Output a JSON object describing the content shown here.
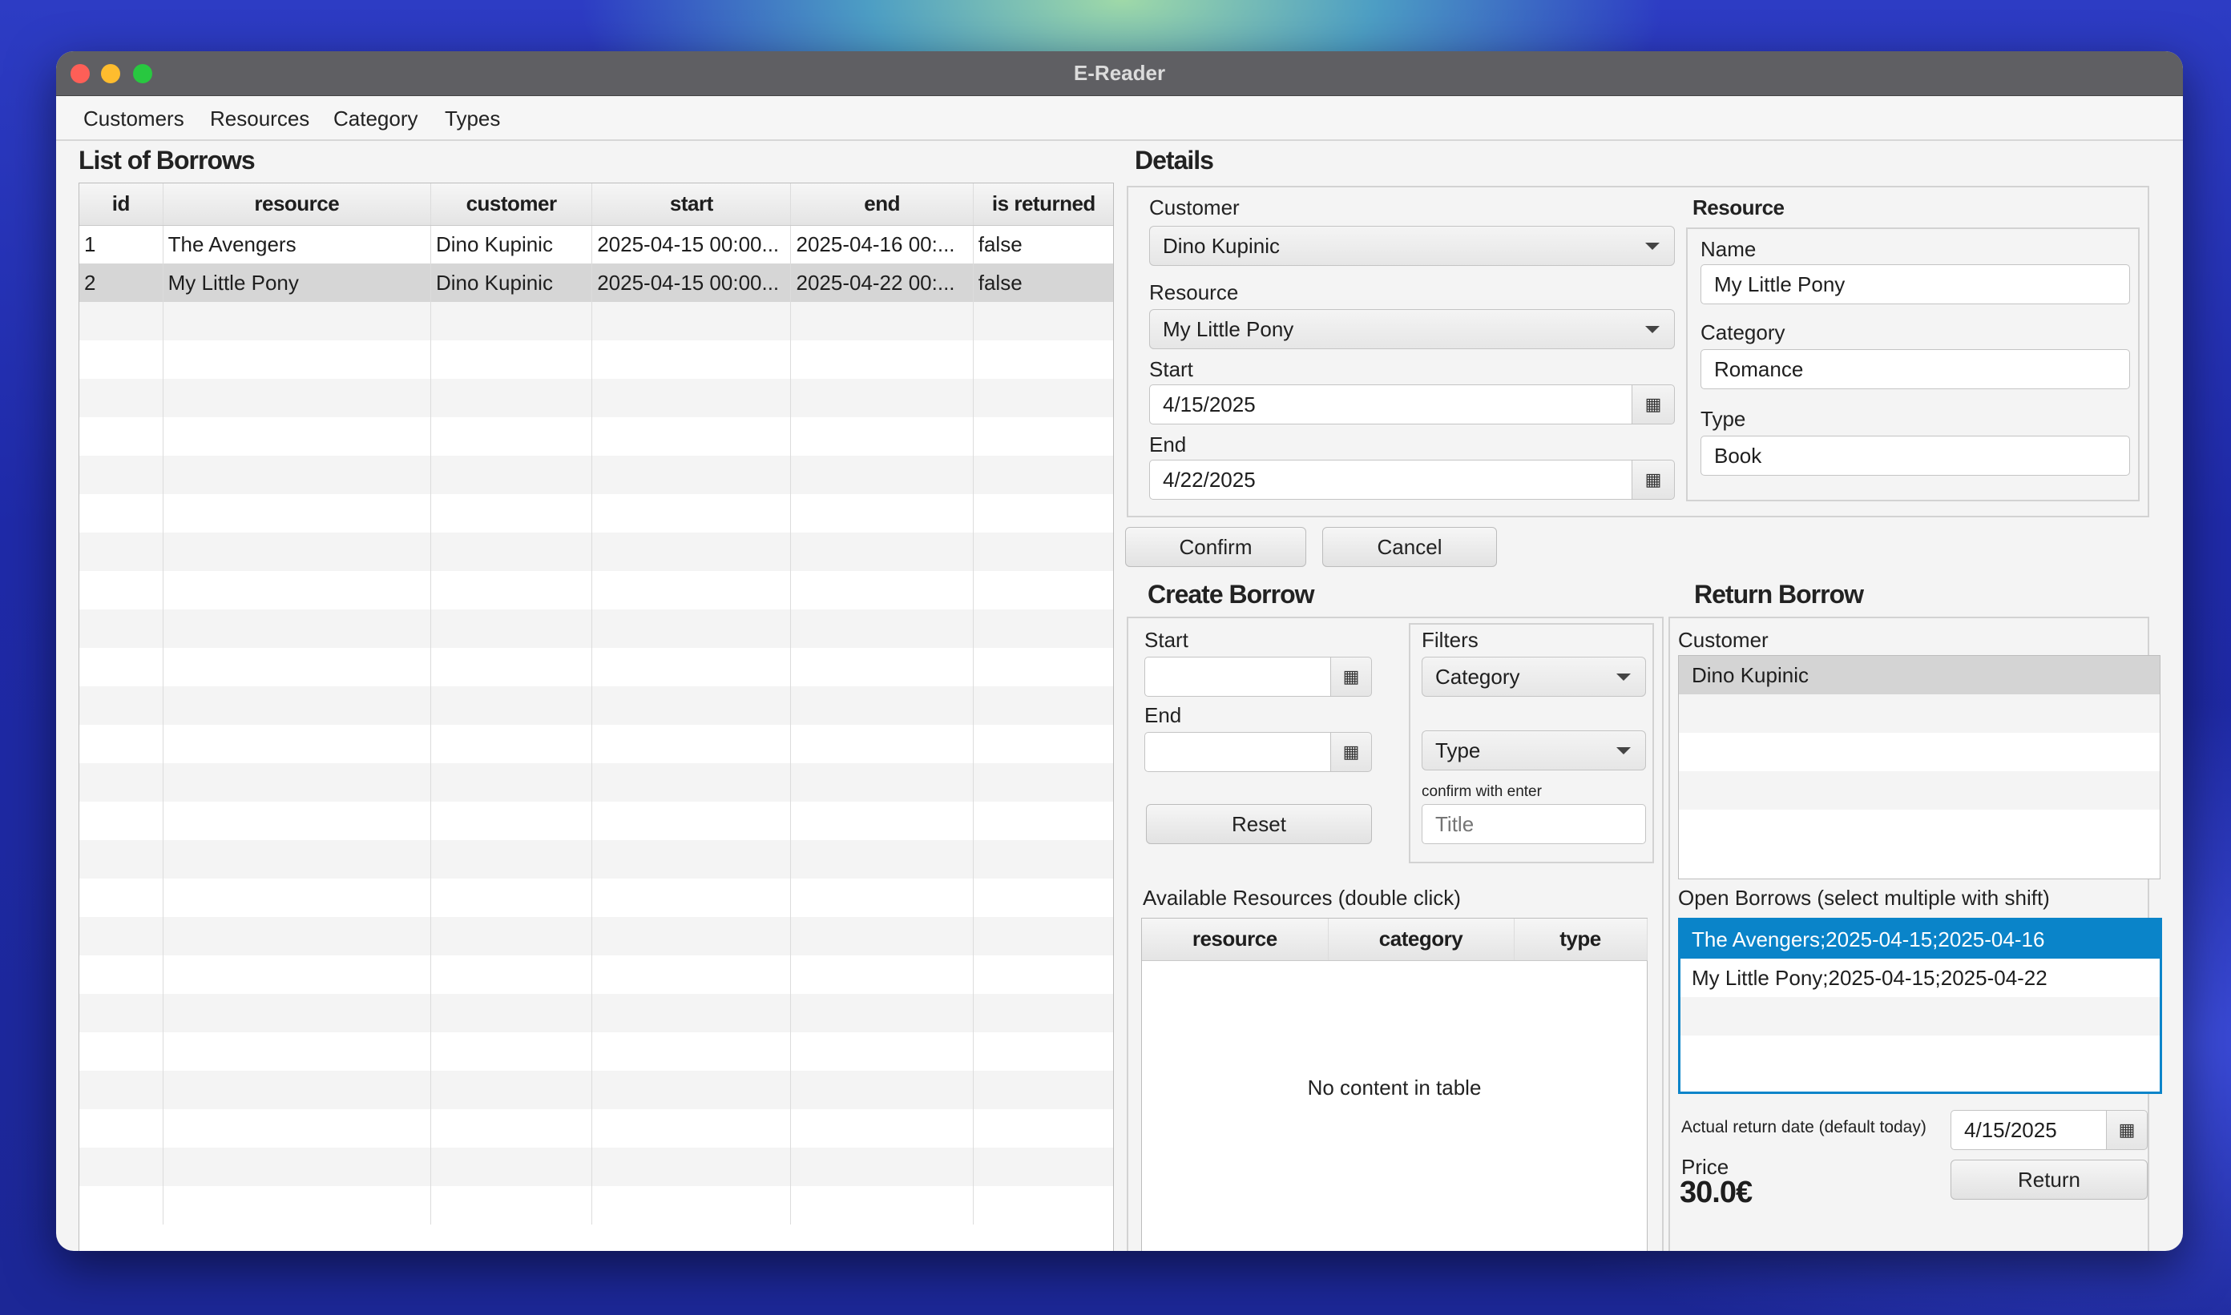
{
  "window": {
    "title": "E-Reader"
  },
  "menu": [
    "Customers",
    "Resources",
    "Category",
    "Types"
  ],
  "borrows": {
    "heading": "List of Borrows",
    "columns": [
      "id",
      "resource",
      "customer",
      "start",
      "end",
      "is returned"
    ],
    "rows": [
      [
        "1",
        "The Avengers",
        "Dino Kupinic",
        "2025-04-15 00:00...",
        "2025-04-16 00:...",
        "false"
      ],
      [
        "2",
        "My Little Pony",
        "Dino Kupinic",
        "2025-04-15 00:00...",
        "2025-04-22 00:...",
        "false"
      ]
    ],
    "selected_row": 2
  },
  "details": {
    "heading": "Details",
    "customer_label": "Customer",
    "customer_value": "Dino Kupinic",
    "resource_label": "Resource",
    "resource_value": "My Little Pony",
    "start_label": "Start",
    "start_value": "4/15/2025",
    "end_label": "End",
    "end_value": "4/22/2025",
    "resource_box": {
      "heading": "Resource",
      "name_label": "Name",
      "name_value": "My Little Pony",
      "category_label": "Category",
      "category_value": "Romance",
      "type_label": "Type",
      "type_value": "Book"
    },
    "confirm": "Confirm",
    "cancel": "Cancel"
  },
  "create": {
    "heading": "Create Borrow",
    "start_label": "Start",
    "end_label": "End",
    "reset": "Reset",
    "filters_label": "Filters",
    "category_combo": "Category",
    "type_combo": "Type",
    "enter_hint": "confirm with enter",
    "title_placeholder": "Title",
    "available_label": "Available Resources (double click)",
    "columns": [
      "resource",
      "category",
      "type"
    ],
    "empty_text": "No content in table"
  },
  "return": {
    "heading": "Return Borrow",
    "customer_label": "Customer",
    "customers": [
      "Dino Kupinic"
    ],
    "open_label": "Open Borrows (select multiple with shift)",
    "open_borrows": [
      "The Avengers;2025-04-15;2025-04-16",
      "My Little Pony;2025-04-15;2025-04-22"
    ],
    "date_label": "Actual return date (default today)",
    "date_value": "4/15/2025",
    "price_label": "Price",
    "price_value": "30.0€",
    "return_button": "Return"
  },
  "colors": {
    "selection": "#0a84c9",
    "selected_row": "#d6d6d6"
  },
  "icons": [
    "calendar-icon",
    "dropdown-arrow-icon"
  ]
}
